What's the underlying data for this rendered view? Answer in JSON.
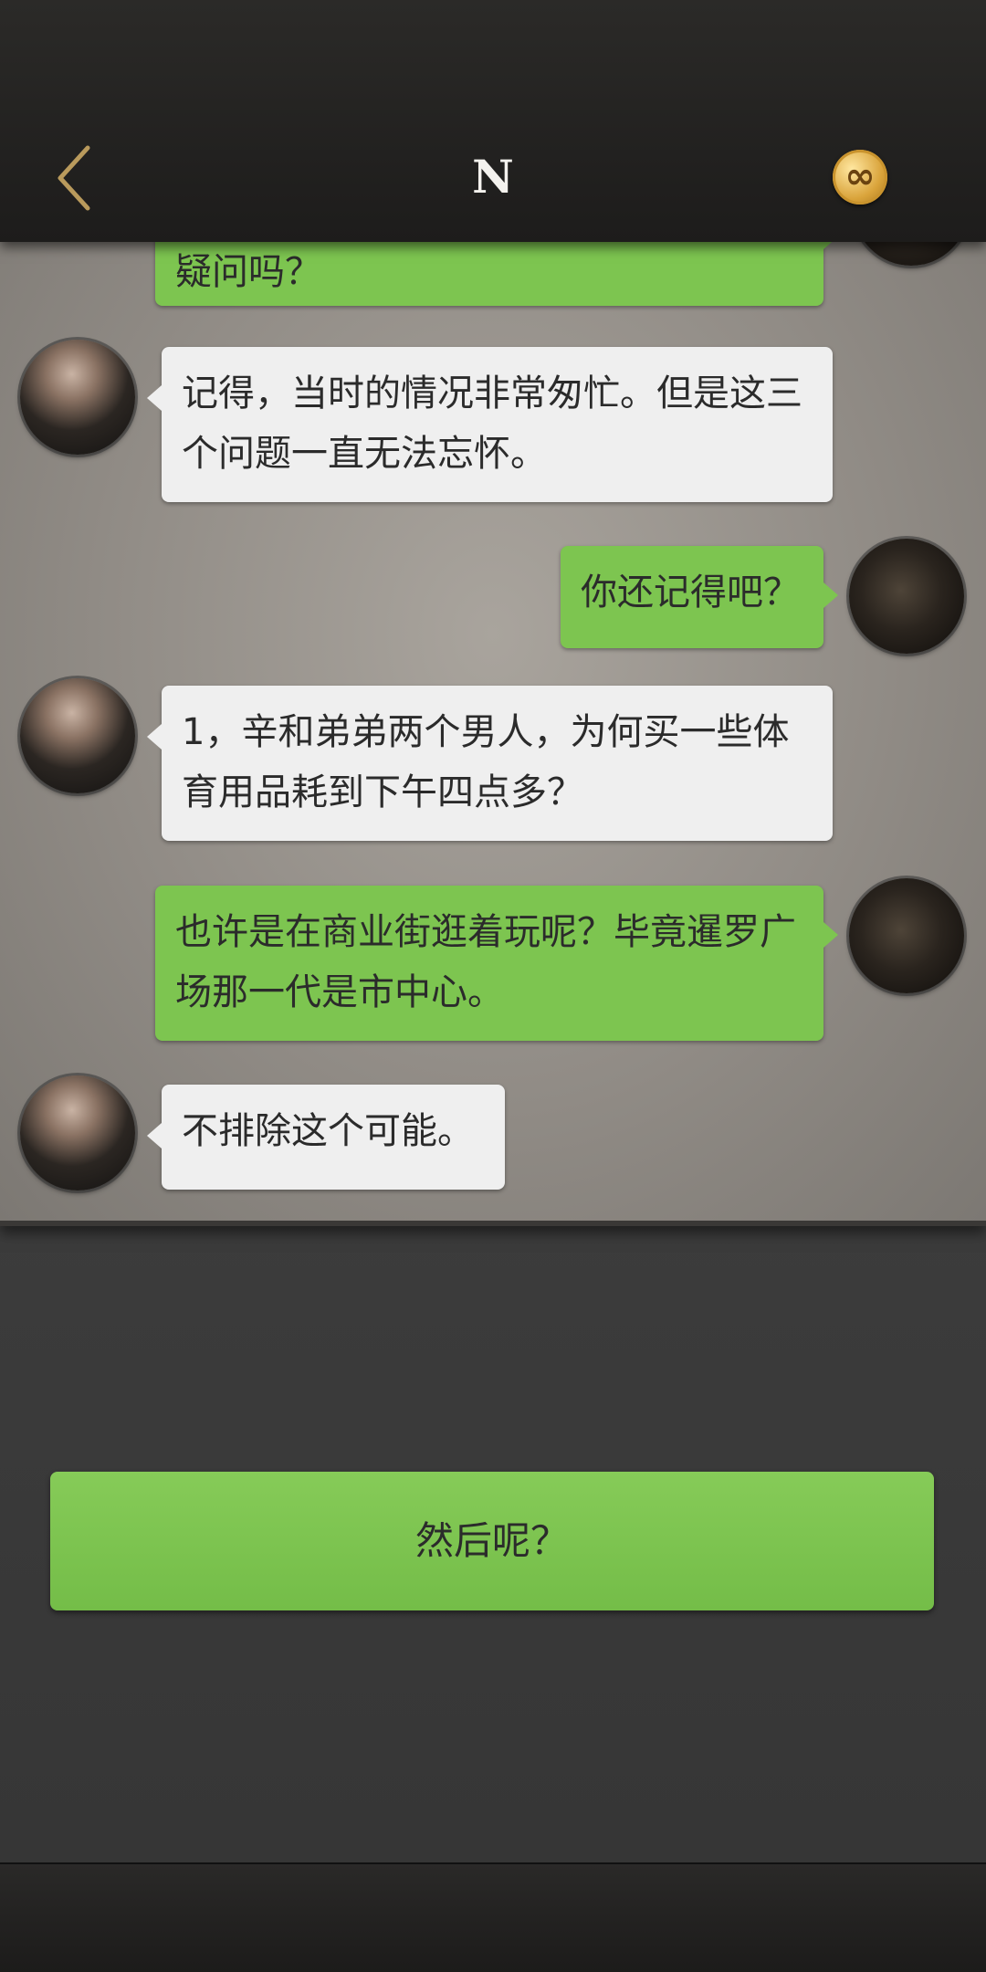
{
  "header": {
    "title": "N",
    "back_icon": "chevron-left-icon",
    "coin_icon": "infinity-coin-icon",
    "coin_symbol": "∞"
  },
  "messages": [
    {
      "side": "right",
      "text": "疑问吗？"
    },
    {
      "side": "left",
      "text": "记得，当时的情况非常匆忙。但是这三个问题一直无法忘怀。"
    },
    {
      "side": "right",
      "text": "你还记得吧？"
    },
    {
      "side": "left",
      "text": "1，辛和弟弟两个男人，为何买一些体育用品耗到下午四点多？"
    },
    {
      "side": "right",
      "text": "也许是在商业街逛着玩呢？毕竟暹罗广场那一代是市中心。"
    },
    {
      "side": "left",
      "text": "不排除这个可能。"
    }
  ],
  "reply_option": {
    "label": "然后呢？"
  },
  "colors": {
    "bubble_green": "#7dc550",
    "bubble_white": "#efefef",
    "accent_gold": "#d9a33a"
  }
}
